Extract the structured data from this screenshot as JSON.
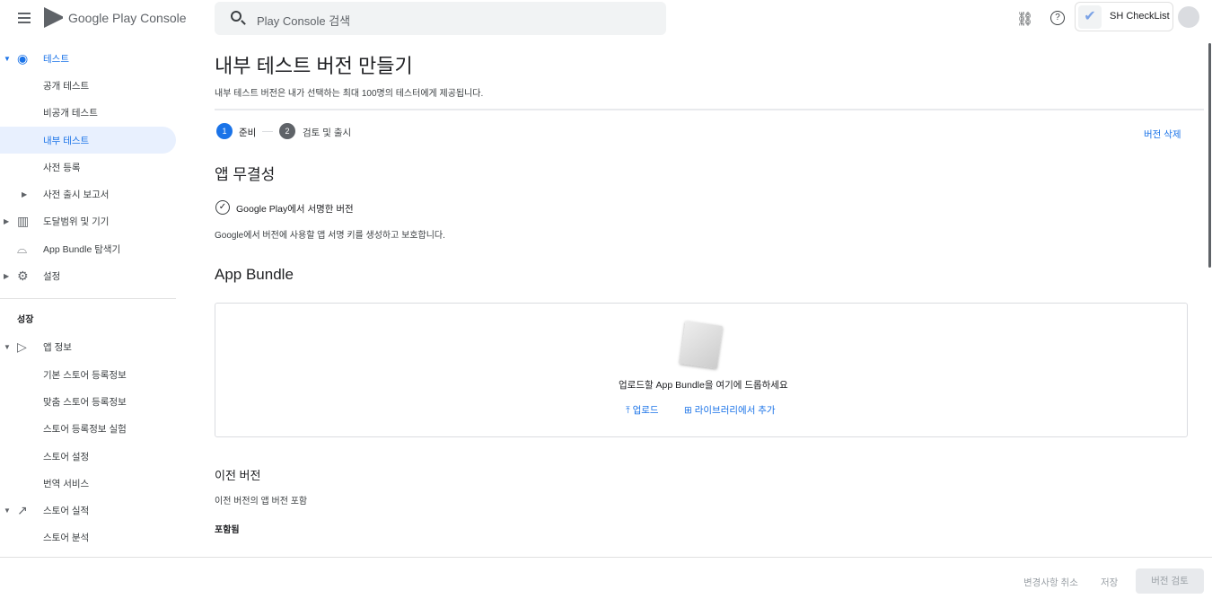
{
  "header": {
    "brand": "Google Play Console",
    "search_placeholder": "Play Console 검색",
    "app_name": "SH CheckList",
    "icons": [
      "menu-icon",
      "link-icon",
      "help-icon",
      "avatar-icon"
    ]
  },
  "sidebar": {
    "items": [
      {
        "label": "테스트",
        "level": 0,
        "expanded": true,
        "icon": "play-circle-icon",
        "selected_parent": true
      },
      {
        "label": "공개 테스트",
        "level": 1
      },
      {
        "label": "비공개 테스트",
        "level": 1
      },
      {
        "label": "내부 테스트",
        "level": 1,
        "active": true
      },
      {
        "label": "사전 등록",
        "level": 1
      },
      {
        "label": "사전 출시 보고서",
        "level": 1,
        "collapsed": true
      },
      {
        "label": "도달범위 및 기기",
        "level": 0,
        "collapsed": true,
        "icon": "bar-chart-icon"
      },
      {
        "label": "App Bundle 탐색기",
        "level": 0,
        "icon": "android-icon"
      },
      {
        "label": "설정",
        "level": 0,
        "collapsed": true,
        "icon": "gear-icon"
      }
    ],
    "section": "성장",
    "items2": [
      {
        "label": "앱 정보",
        "level": 0,
        "expanded": true,
        "icon": "play-icon"
      },
      {
        "label": "기본 스토어 등록정보",
        "level": 1
      },
      {
        "label": "맞춤 스토어 등록정보",
        "level": 1
      },
      {
        "label": "스토어 등록정보 실험",
        "level": 1
      },
      {
        "label": "스토어 설정",
        "level": 1
      },
      {
        "label": "번역 서비스",
        "level": 1
      },
      {
        "label": "스토어 실적",
        "level": 0,
        "expanded": true,
        "icon": "trending-up-icon"
      },
      {
        "label": "스토어 분석",
        "level": 1
      }
    ]
  },
  "main": {
    "title": "내부 테스트 버전 만들기",
    "subtitle": "내부 테스트 버전은 내가 선택하는 최대 100명의 테스터에게 제공됩니다.",
    "steps": [
      {
        "num": "1",
        "label": "준비",
        "active": true
      },
      {
        "num": "2",
        "label": "검토 및 출시"
      }
    ],
    "delete_label": "버전 삭제",
    "integrity": {
      "title": "앱 무결성",
      "check": "Google Play에서 서명한 버전",
      "desc": "Google에서 버전에 사용할 앱 서명 키를 생성하고 보호합니다."
    },
    "bundle": {
      "title": "App Bundle",
      "drop_text": "업로드할 App Bundle을 여기에 드롭하세요",
      "upload": "업로드",
      "library": "라이브러리에서 추가"
    },
    "previous": {
      "title": "이전 버전",
      "desc": "이전 버전의 앱 버전 포함",
      "included": "포함됨"
    }
  },
  "footer": {
    "discard": "변경사항 취소",
    "save": "저장",
    "review": "버전 검토"
  },
  "colors": {
    "accent": "#1a73e8",
    "active_bg": "#e8f0fe"
  }
}
